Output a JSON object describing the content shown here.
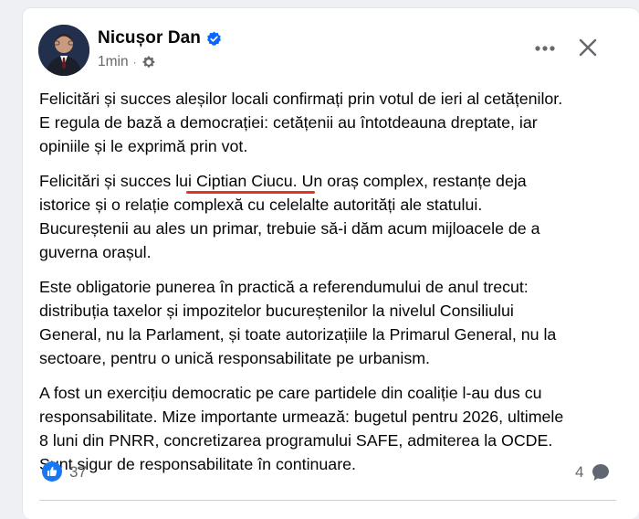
{
  "post": {
    "author": "Nicușor Dan",
    "timestamp": "1min",
    "separator": "·",
    "audience_icon": "gear-icon",
    "verified_icon": "verified-badge-icon",
    "paragraphs": [
      {
        "lines": [
          "Felicitări și succes aleșilor locali confirmați prin votul de ieri al cetățenilor.",
          "E regula de bază a democrației: cetățenii au întotdeauna dreptate, iar",
          "opiniile și le exprimă prin vot."
        ]
      },
      {
        "line1_before": "Felicitări și succes lu",
        "line1_mark": "i Ciptian Ciucu. U",
        "line1_after": "n oraș complex, restanțe deja",
        "lines": [
          "istorice și o relație complexă cu celelalte autorități ale statului.",
          "Bucureștenii au ales un primar, trebuie să-i dăm acum mijloacele de a",
          "guverna orașul."
        ]
      },
      {
        "lines": [
          "Este obligatorie punerea în practică a referendumului de anul trecut:",
          "distribuția taxelor și impozitelor bucureștenilor la nivelul Consiliului",
          "General, nu la Parlament, și toate autorizațiile la Primarul General, nu la",
          "sectoare, pentru o unică responsabilitate pe urbanism."
        ]
      },
      {
        "lines": [
          "A fost un exercițiu democratic pe care partidele din coaliție l-au dus cu",
          "responsabilitate. Mize importante urmează: bugetul pentru 2026, ultimele",
          "8 luni din PNRR, concretizarea programului SAFE, admiterea la OCDE.",
          "Sunt sigur de responsabilitate în continuare."
        ]
      }
    ],
    "reactions": {
      "like_count": "37",
      "comment_count": "4"
    }
  },
  "colors": {
    "facebook_blue": "#0866ff",
    "highlight_red": "#e53222",
    "muted_text": "#65676b"
  }
}
